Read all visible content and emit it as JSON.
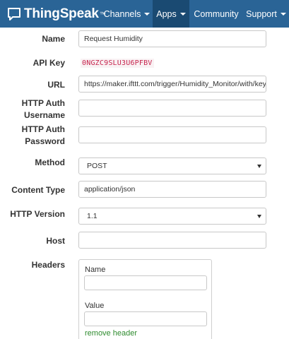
{
  "brand": {
    "name": "ThingSpeak",
    "trademark": "™",
    "icon": "chat-bubble-logo-icon"
  },
  "nav": {
    "items": [
      {
        "label": "Channels",
        "dropdown": true
      },
      {
        "label": "Apps",
        "dropdown": true,
        "active": true
      },
      {
        "label": "Community",
        "dropdown": false
      },
      {
        "label": "Support",
        "dropdown": true
      }
    ]
  },
  "form": {
    "name": {
      "label": "Name",
      "value": "Request Humidity"
    },
    "api_key": {
      "label": "API Key",
      "value": "0NGZC9SLU3U6PFBV"
    },
    "url": {
      "label": "URL",
      "value": "https://maker.ifttt.com/trigger/Humidity_Monitor/with/key/zg"
    },
    "http_auth_username": {
      "label_line1": "HTTP Auth",
      "label_line2": "Username",
      "value": ""
    },
    "http_auth_password": {
      "label_line1": "HTTP Auth",
      "label_line2": "Password",
      "value": ""
    },
    "method": {
      "label": "Method",
      "selected": "POST"
    },
    "content_type": {
      "label": "Content Type",
      "value": "application/json"
    },
    "http_version": {
      "label": "HTTP Version",
      "selected": "1.1"
    },
    "host": {
      "label": "Host",
      "value": ""
    },
    "headers": {
      "label": "Headers",
      "name_label": "Name",
      "name_value": "",
      "value_label": "Value",
      "value_value": "",
      "remove_label": "remove header"
    }
  },
  "colors": {
    "navbar": "#2a6496",
    "navbar_active": "#1a4a72",
    "api_key_text": "#c7254e",
    "remove_link": "#2e8b2e"
  }
}
